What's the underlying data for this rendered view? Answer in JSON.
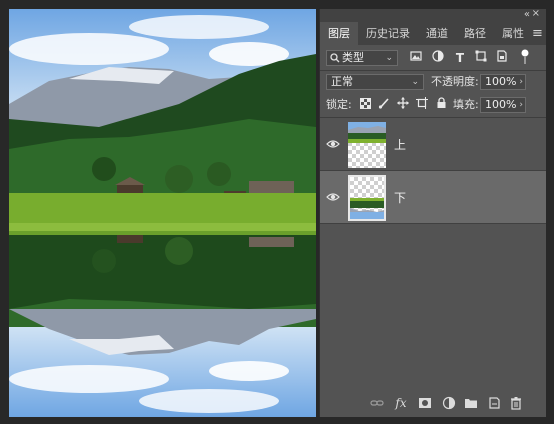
{
  "panel": {
    "tabs": [
      {
        "label": "图层",
        "active": true
      },
      {
        "label": "历史记录",
        "active": false
      },
      {
        "label": "通道",
        "active": false
      },
      {
        "label": "路径",
        "active": false
      },
      {
        "label": "属性",
        "active": false
      }
    ],
    "collapse_glyph": "«",
    "close_glyph": "×",
    "menu_glyph": "≡",
    "filter": {
      "kind_label": "类型",
      "icons": [
        "image-filter-icon",
        "adjustment-filter-icon",
        "type-filter-icon",
        "shape-filter-icon",
        "smart-object-filter-icon"
      ]
    },
    "blend": {
      "mode": "正常",
      "opacity_label": "不透明度:",
      "opacity_value": "100%"
    },
    "lock": {
      "label": "锁定:",
      "fill_label": "填充:",
      "fill_value": "100%"
    },
    "layers": [
      {
        "name": "上",
        "visible": true,
        "selected": false
      },
      {
        "name": "下",
        "visible": true,
        "selected": true
      }
    ],
    "bottom_icons": [
      "link-layers-icon",
      "fx-icon",
      "add-mask-icon",
      "adjustment-layer-icon",
      "new-group-icon",
      "new-layer-icon",
      "delete-layer-icon"
    ]
  },
  "colors": {
    "panel_bg": "#535353",
    "tab_bar_bg": "#424242",
    "selected_layer_bg": "#6a6a6a",
    "app_bg": "#282828"
  }
}
